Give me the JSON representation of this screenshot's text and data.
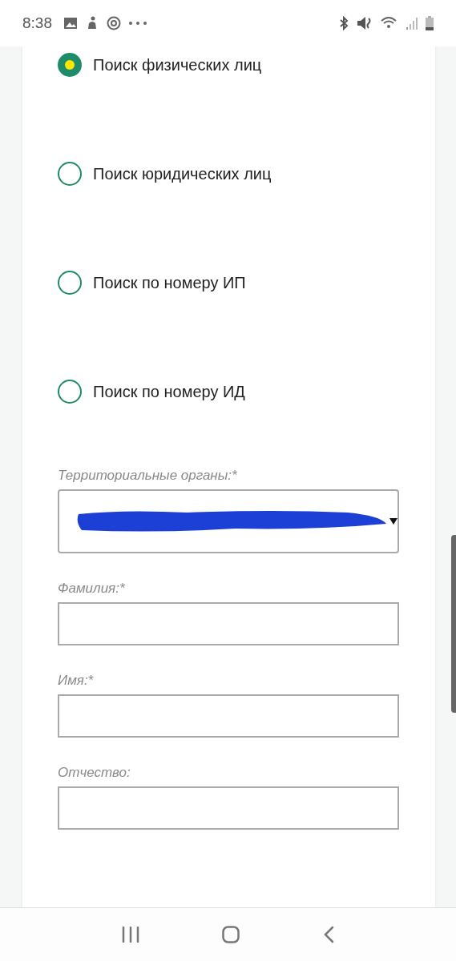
{
  "status_bar": {
    "time": "8:38"
  },
  "search_modes": [
    {
      "label": "Поиск физических лиц",
      "selected": true
    },
    {
      "label": "Поиск юридических лиц",
      "selected": false
    },
    {
      "label": "Поиск по номеру ИП",
      "selected": false
    },
    {
      "label": "Поиск по номеру ИД",
      "selected": false
    }
  ],
  "fields": [
    {
      "kind": "select",
      "label": "Территориальные органы:*",
      "redacted": true
    },
    {
      "kind": "text",
      "label": "Фамилия:*"
    },
    {
      "kind": "text",
      "label": "Имя:*"
    },
    {
      "kind": "text",
      "label": "Отчество:"
    }
  ]
}
